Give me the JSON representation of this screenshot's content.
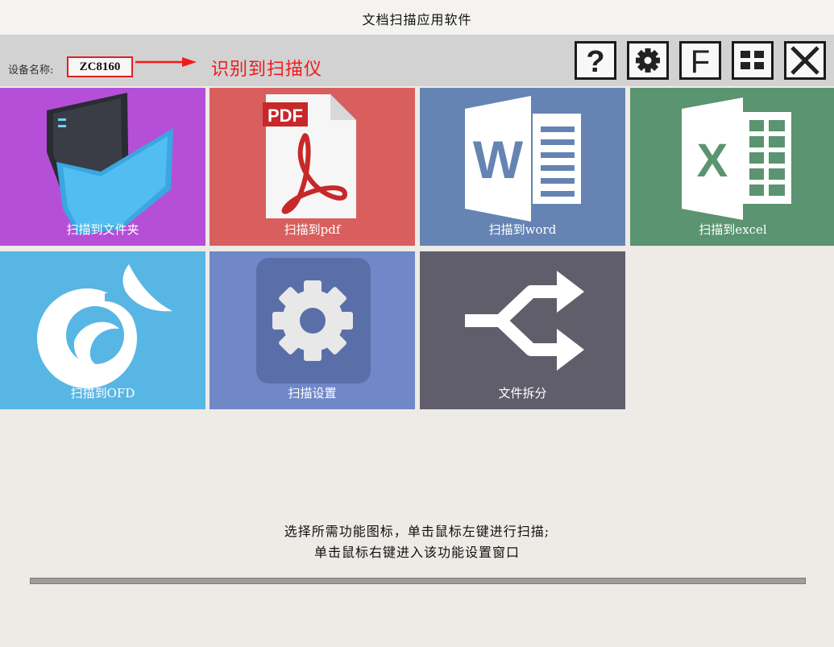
{
  "window": {
    "title": "文档扫描应用软件"
  },
  "device": {
    "label": "设备名称:",
    "name": "ZC8160",
    "annotation": "识别到扫描仪"
  },
  "toolbar": {
    "buttons": [
      {
        "name": "help",
        "icon": "question-mark-icon"
      },
      {
        "name": "settings",
        "icon": "gear-icon"
      },
      {
        "name": "f",
        "icon": "letter-f-icon",
        "text": "F"
      },
      {
        "name": "grid",
        "icon": "grid-icon"
      },
      {
        "name": "close",
        "icon": "close-icon"
      }
    ]
  },
  "tiles": [
    {
      "label": "扫描到文件夹",
      "color": "#b64fd8",
      "icon": "folder-icon"
    },
    {
      "label": "扫描到pdf",
      "color": "#d95f5f",
      "icon": "pdf-icon",
      "icon_text": "PDF"
    },
    {
      "label": "扫描到word",
      "color": "#6584b3",
      "icon": "word-icon",
      "icon_text": "W"
    },
    {
      "label": "扫描到excel",
      "color": "#5a9470",
      "icon": "excel-icon",
      "icon_text": "X"
    },
    {
      "label": "扫描到OFD",
      "color": "#58b6e4",
      "icon": "ofd-icon"
    },
    {
      "label": "扫描设置",
      "color": "#7088c8",
      "icon": "gear-icon"
    },
    {
      "label": "文件拆分",
      "color": "#5f5e6a",
      "icon": "split-arrows-icon"
    }
  ],
  "hint": {
    "line1": "选择所需功能图标，单击鼠标左键进行扫描;",
    "line2": "单击鼠标右键进入该功能设置窗口"
  },
  "progress": {
    "value": 0
  }
}
